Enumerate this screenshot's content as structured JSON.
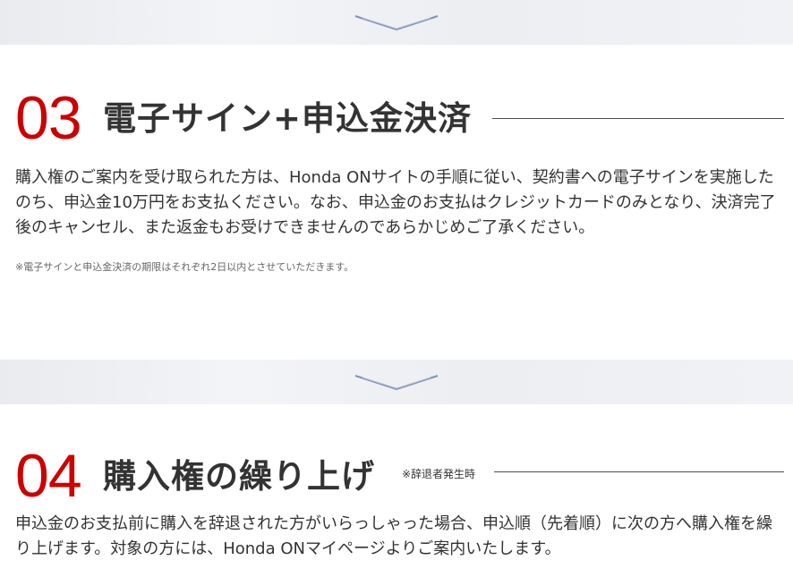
{
  "steps": [
    {
      "number": "03",
      "title": "電子サイン+申込金決済",
      "body": "購入権のご案内を受け取られた方は、Honda ONサイトの手順に従い、契約書への電子サインを実施したのち、申込金10万円をお支払ください。なお、申込金のお支払はクレジットカードのみとなり、決済完了後のキャンセル、また返金もお受けできませんのであらかじめご了承ください。",
      "note": "※電子サインと申込金決済の期限はそれぞれ2日以内とさせていただきます。"
    },
    {
      "number": "04",
      "title": "購入権の繰り上げ",
      "title_note": "※辞退者発生時",
      "body": "申込金のお支払前に購入を辞退された方がいらっしゃった場合、申込順（先着順）に次の方へ購入権を繰り上げます。対象の方には、Honda ONマイページよりご案内いたします。"
    }
  ],
  "colors": {
    "accent": "#cc0000",
    "text": "#333333",
    "band": "#eceef2",
    "chevron": "#7f93b5"
  },
  "icons": [
    "chevron-down-icon"
  ]
}
